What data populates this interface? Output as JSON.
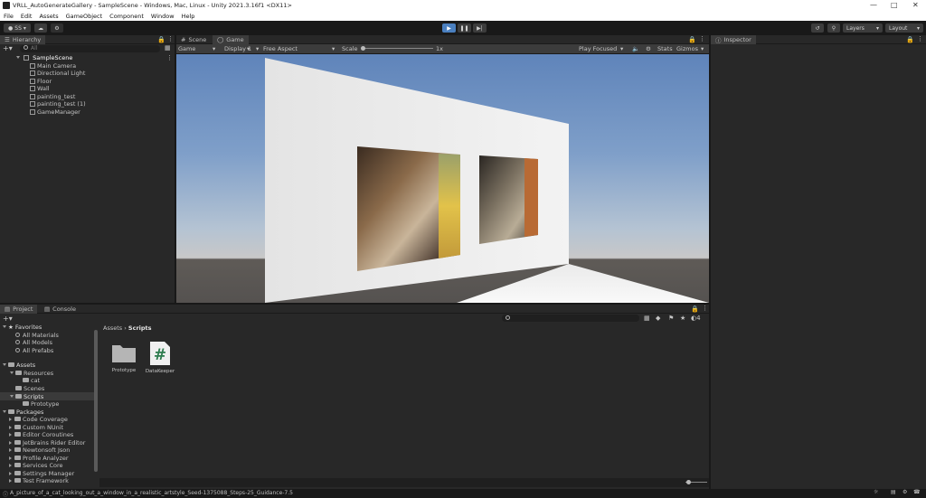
{
  "window": {
    "title": "VRLL_AutoGenerateGallery - SampleScene - Windows, Mac, Linux - Unity 2021.3.16f1 <DX11>"
  },
  "menu": [
    "File",
    "Edit",
    "Assets",
    "GameObject",
    "Component",
    "Window",
    "Help"
  ],
  "toolbar": {
    "account": "SS",
    "layers": "Layers",
    "layout": "Layout"
  },
  "hierarchy": {
    "tab": "Hierarchy",
    "search_placeholder": "All",
    "scene": "SampleScene",
    "items": [
      "Main Camera",
      "Directional Light",
      "Floor",
      "Wall",
      "painting_test",
      "painting_test (1)",
      "GameManager"
    ]
  },
  "center_tabs": {
    "scene": "Scene",
    "game": "Game"
  },
  "game_bar": {
    "mode": "Game",
    "display": "Display 1",
    "aspect": "Free Aspect",
    "scale_label": "Scale",
    "scale_value": "1x",
    "play_focused": "Play Focused",
    "stats": "Stats",
    "gizmos": "Gizmos"
  },
  "inspector": {
    "tab": "Inspector"
  },
  "project": {
    "tabs": [
      "Project",
      "Console"
    ],
    "breadcrumb": [
      "Assets",
      "Scripts"
    ],
    "favorites_label": "Favorites",
    "favorites": [
      "All Materials",
      "All Models",
      "All Prefabs"
    ],
    "assets_label": "Assets",
    "assets_tree": {
      "resources": "Resources",
      "cat": "cat",
      "scenes": "Scenes",
      "scripts": "Scripts",
      "prototype": "Prototype"
    },
    "packages_label": "Packages",
    "packages": [
      "Code Coverage",
      "Custom NUnit",
      "Editor Coroutines",
      "JetBrains Rider Editor",
      "Newtonsoft Json",
      "Profile Analyzer",
      "Services Core",
      "Settings Manager",
      "Test Framework"
    ],
    "grid_items": [
      {
        "label": "Prototype",
        "icon": "folder-icon"
      },
      {
        "label": "DataKeeper",
        "icon": "csharp-script-icon"
      }
    ]
  },
  "status": {
    "message": "A_picture_of_a_cat_looking_out_a_window_in_a_realistic_artstyle_Seed-1375088_Steps-25_Guidance-7.5"
  },
  "colors": {
    "accent_play": "#4a7fbf",
    "panel": "#282828",
    "bg": "#191919"
  }
}
